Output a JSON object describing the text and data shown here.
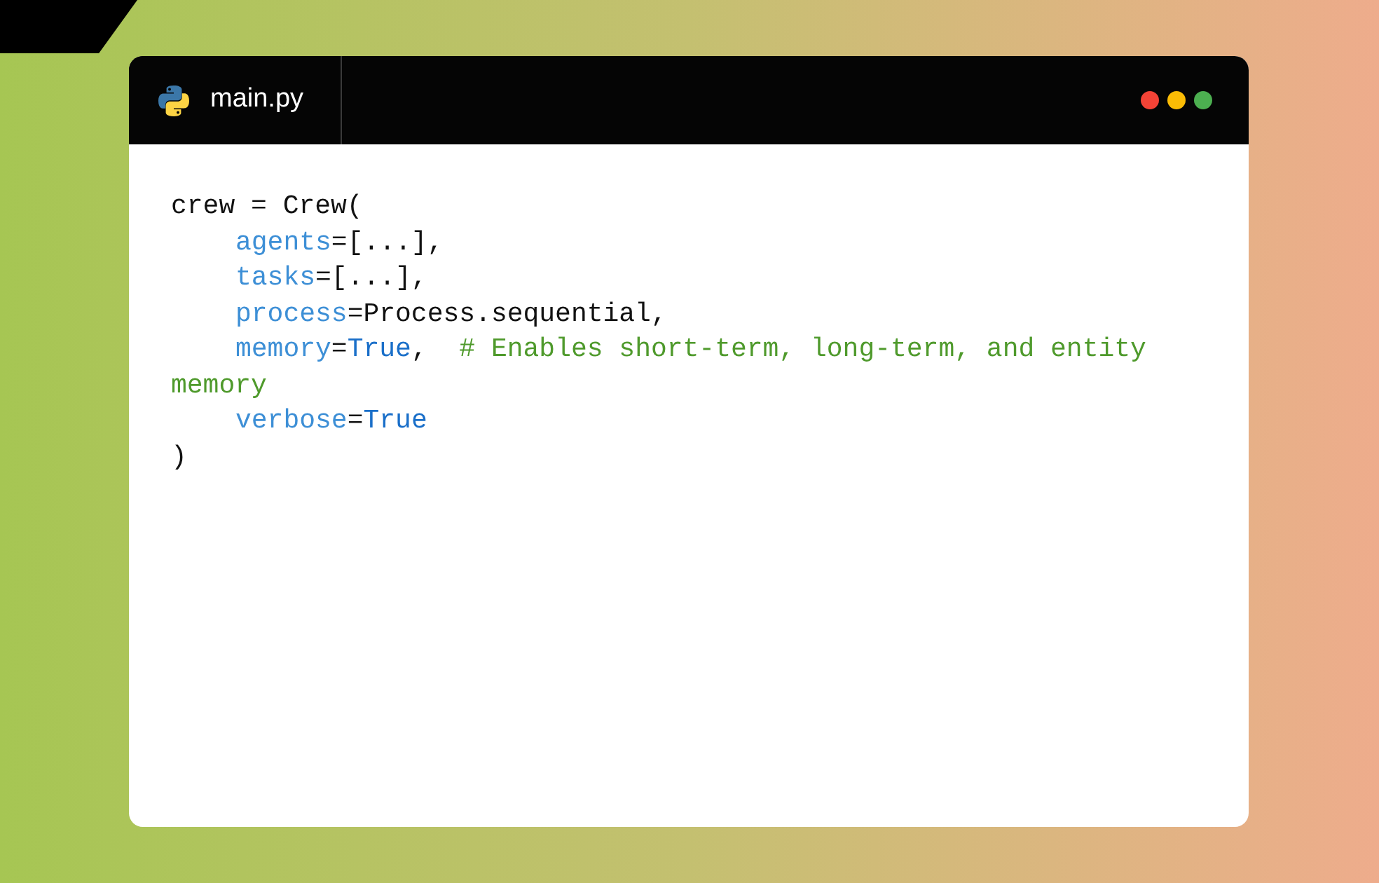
{
  "editor": {
    "tab": {
      "filename": "main.py",
      "selected": true
    },
    "window_controls": [
      {
        "color": "#f44336"
      },
      {
        "color": "#fbbc05"
      },
      {
        "color": "#4caf50"
      }
    ],
    "code_lines": [
      {
        "indent": false,
        "tokens": [
          {
            "kind": "plain",
            "text": "crew = Crew("
          }
        ]
      },
      {
        "indent": true,
        "tokens": [
          {
            "kind": "param",
            "text": "agents"
          },
          {
            "kind": "plain",
            "text": "=[...],"
          }
        ]
      },
      {
        "indent": true,
        "tokens": [
          {
            "kind": "param",
            "text": "tasks"
          },
          {
            "kind": "plain",
            "text": "=[...],"
          }
        ]
      },
      {
        "indent": true,
        "tokens": [
          {
            "kind": "param",
            "text": "process"
          },
          {
            "kind": "plain",
            "text": "=Process.sequential,"
          }
        ]
      },
      {
        "indent": true,
        "tokens": [
          {
            "kind": "param",
            "text": "memory"
          },
          {
            "kind": "plain",
            "text": "="
          },
          {
            "kind": "constant",
            "text": "True"
          },
          {
            "kind": "plain",
            "text": ",  "
          },
          {
            "kind": "comment",
            "text": "# Enables short-term, long-term, and entity"
          }
        ]
      },
      {
        "indent": false,
        "tokens": [
          {
            "kind": "comment",
            "text": "memory"
          }
        ]
      },
      {
        "indent": true,
        "tokens": [
          {
            "kind": "param",
            "text": "verbose"
          },
          {
            "kind": "plain",
            "text": "="
          },
          {
            "kind": "constant",
            "text": "True"
          }
        ]
      },
      {
        "indent": false,
        "tokens": [
          {
            "kind": "plain",
            "text": ")"
          }
        ]
      }
    ]
  }
}
